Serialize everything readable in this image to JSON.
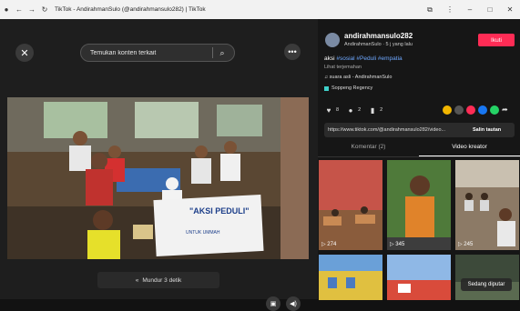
{
  "window": {
    "title": "TikTok - AndirahmanSulo (@andirahmansulo282) | TikTok"
  },
  "player": {
    "search_placeholder": "Temukan konten terkait",
    "back_label": "Mundur 3 detik",
    "banner_title": "\"AKSI PEDULI\"",
    "banner_sub": "UNTUK UMMAH"
  },
  "author": {
    "name": "andirahmansulo282",
    "subline": "AndirahmanSulo · 5 j yang lalu",
    "follow_label": "Ikuti"
  },
  "caption": {
    "text": "aksi",
    "tags": "#sosial #Peduli #empatia",
    "translate": "Lihat terjemahan",
    "sound": "♫ suara asli - AndirahmanSulo",
    "location": "Soppeng Regency"
  },
  "stats": {
    "likes": "8",
    "comments": "2",
    "saves": "2"
  },
  "share_colors": [
    "#f2b600",
    "#555555",
    "#fe2c55",
    "#1877f2",
    "#25d366"
  ],
  "link": {
    "url": "https://www.tiktok.com/@andirahmansulo282/video...",
    "copy_label": "Salin tautan"
  },
  "tabs": [
    "Komentar (2)",
    "Video kreator"
  ],
  "thumbs": [
    {
      "views": "274"
    },
    {
      "views": "345"
    },
    {
      "views": "245"
    }
  ],
  "autoplay_label": "Sedang diputar"
}
